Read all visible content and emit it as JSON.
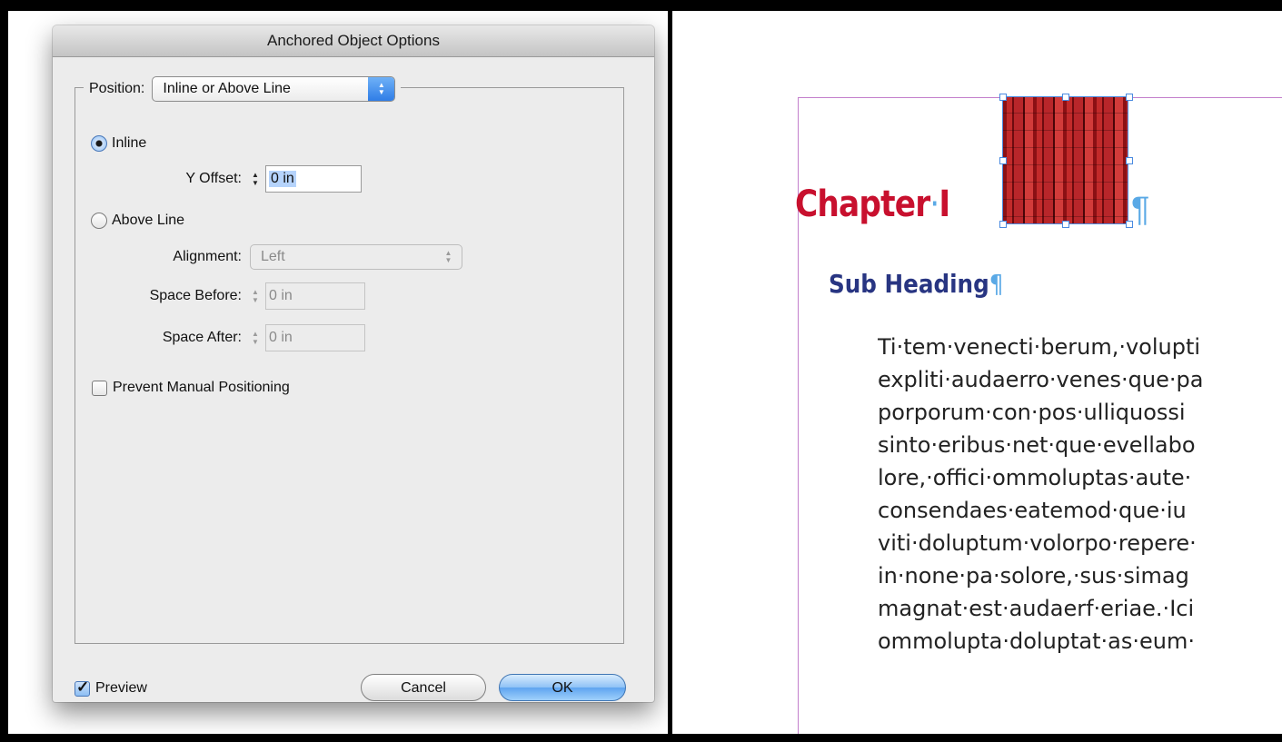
{
  "dialog": {
    "title": "Anchored Object Options",
    "position_label": "Position:",
    "position_value": "Inline or Above Line",
    "inline": {
      "label": "Inline",
      "selected": true,
      "y_offset_label": "Y Offset:",
      "y_offset_value": "0 in"
    },
    "above_line": {
      "label": "Above Line",
      "selected": false,
      "alignment_label": "Alignment:",
      "alignment_value": "Left",
      "space_before_label": "Space Before:",
      "space_before_value": "0 in",
      "space_after_label": "Space After:",
      "space_after_value": "0 in"
    },
    "prevent_manual": {
      "label": "Prevent Manual Positioning",
      "checked": false
    },
    "preview": {
      "label": "Preview",
      "checked": true
    },
    "cancel_label": "Cancel",
    "ok_label": "OK"
  },
  "document": {
    "chapter_word": "Chapter",
    "chapter_num": "I",
    "pilcrow": "¶",
    "subheading": "Sub Heading",
    "body_lines": [
      "Ti·tem·venecti·berum,·volupti",
      "expliti·audaerro·venes·que·pa",
      "porporum·con·pos·ulliquossi",
      "sinto·eribus·net·que·evellabo",
      "lore,·offici·ommoluptas·aute·",
      "consendaes·eatemod·que·iu",
      "viti·doluptum·volorpo·repere·",
      "in·none·pa·solore,·sus·simag",
      "magnat·est·audaerf·eriae.·Ici",
      "ommolupta·doluptat·as·eum·"
    ]
  },
  "colors": {
    "chapter": "#c8102e",
    "subheading": "#283582",
    "frame": "#c37fcc",
    "selection": "#4a8ae0"
  }
}
